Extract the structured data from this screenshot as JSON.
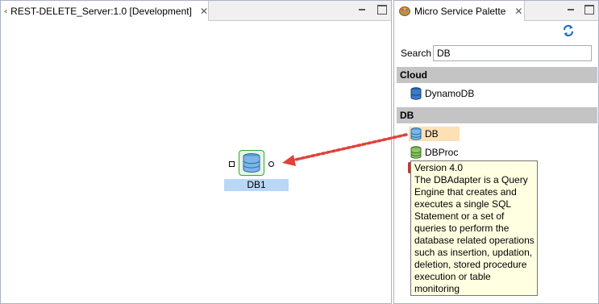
{
  "editor": {
    "tab_title": "REST-DELETE_Server:1.0 [Development]",
    "node_label": "DB1"
  },
  "palette": {
    "tab_title": "Micro Service Palette",
    "search": {
      "label": "Search",
      "value": "DB"
    },
    "sections": [
      {
        "header": "Cloud",
        "items": [
          "DynamoDB"
        ]
      },
      {
        "header": "DB",
        "items": [
          "DB",
          "DBProc"
        ]
      }
    ]
  },
  "tooltip": {
    "lines": [
      "Version 4.0",
      "The DBAdapter is a Query",
      "Engine that creates and",
      "executes a single SQL",
      "Statement or a set of",
      "queries to perform the",
      "database related operations",
      "such as insertion, updation,",
      "deletion, stored procedure",
      "execution or table",
      "monitoring"
    ]
  },
  "colors": {
    "selection_highlight": "#fde0b4",
    "node_label_bg": "#b9d7f6",
    "drag_arrow": "#e0413c",
    "tooltip_bg": "#ffffe1",
    "section_header_bg": "#c4c4c4"
  },
  "icons": {
    "editor_tab": "flow-diagram-icon",
    "palette_tab": "palette-icon",
    "refresh": "refresh-icon",
    "db": "database-icon"
  }
}
